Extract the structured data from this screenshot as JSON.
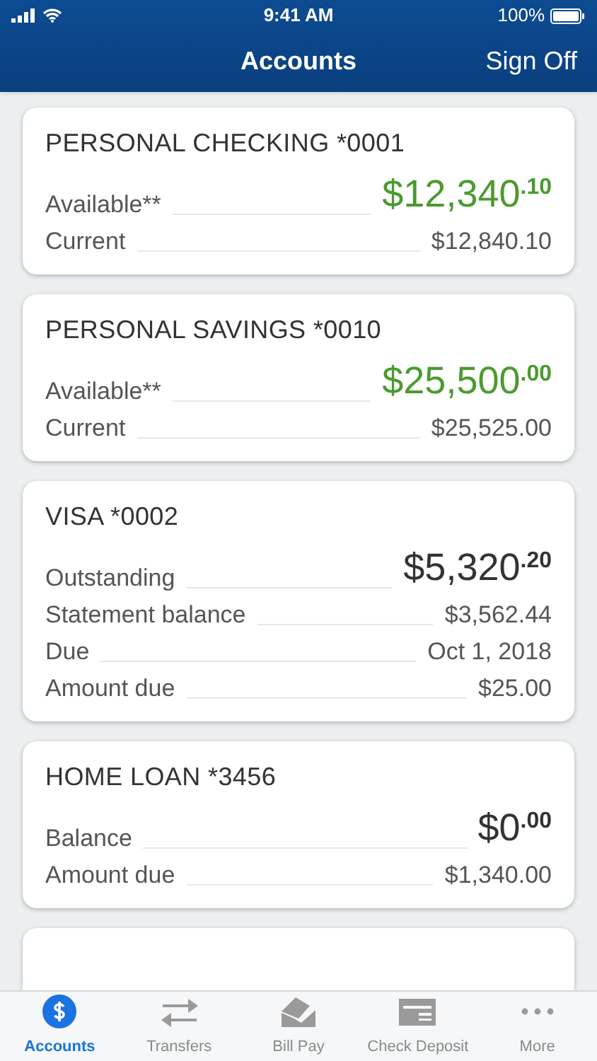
{
  "status_bar": {
    "time": "9:41 AM",
    "battery": "100%"
  },
  "nav": {
    "title": "Accounts",
    "action": "Sign Off"
  },
  "accounts": [
    {
      "title": "PERSONAL CHECKING *0001",
      "rows": [
        {
          "kind": "primary",
          "label": "Available**",
          "amount": "$12,340",
          "cents": ".10",
          "color": "#4b9a2f"
        },
        {
          "kind": "detail",
          "label": "Current",
          "value": "$12,840.10"
        }
      ]
    },
    {
      "title": "PERSONAL SAVINGS *0010",
      "rows": [
        {
          "kind": "primary",
          "label": "Available**",
          "amount": "$25,500",
          "cents": ".00",
          "color": "#4b9a2f"
        },
        {
          "kind": "detail",
          "label": "Current",
          "value": "$25,525.00"
        }
      ]
    },
    {
      "title": "VISA *0002",
      "rows": [
        {
          "kind": "primary",
          "label": "Outstanding",
          "amount": "$5,320",
          "cents": ".20",
          "color": "#333333"
        },
        {
          "kind": "detail",
          "label": "Statement balance",
          "value": "$3,562.44"
        },
        {
          "kind": "detail",
          "label": "Due",
          "value": "Oct 1, 2018"
        },
        {
          "kind": "detail",
          "label": "Amount due",
          "value": "$25.00"
        }
      ]
    },
    {
      "title": "HOME LOAN *3456",
      "rows": [
        {
          "kind": "primary",
          "label": "Balance",
          "amount": "$0",
          "cents": ".00",
          "color": "#333333"
        },
        {
          "kind": "detail",
          "label": "Amount due",
          "value": "$1,340.00"
        }
      ]
    }
  ],
  "tabs": [
    {
      "label": "Accounts",
      "selected": true
    },
    {
      "label": "Transfers",
      "selected": false
    },
    {
      "label": "Bill Pay",
      "selected": false
    },
    {
      "label": "Check Deposit",
      "selected": false
    },
    {
      "label": "More",
      "selected": false
    }
  ]
}
